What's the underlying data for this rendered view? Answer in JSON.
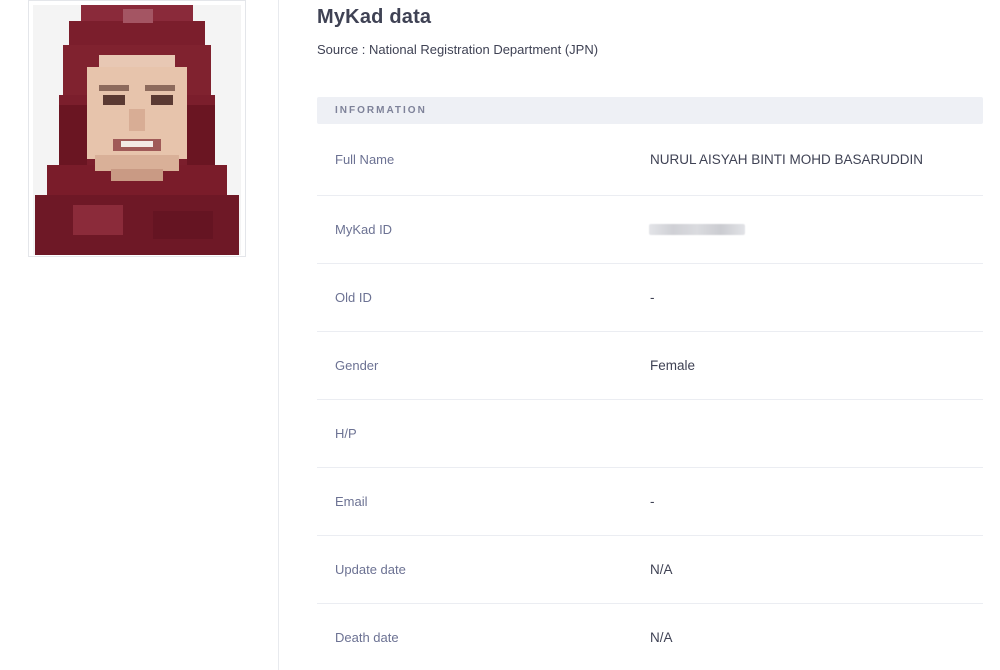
{
  "header": {
    "title": "MyKad data",
    "subtitle": "Source : National Registration Department (JPN)"
  },
  "photo": {
    "icon": "profile-photo-pixelated",
    "colors": {
      "hijab": "#7b1e2c",
      "face": "#e7c4ac",
      "background": "#f4f4f4"
    }
  },
  "information": {
    "heading": "INFORMATION",
    "rows": [
      {
        "label": "Full Name",
        "value": "NURUL AISYAH BINTI MOHD BASARUDDIN"
      },
      {
        "label": "MyKad ID",
        "value": ""
      },
      {
        "label": "Old ID",
        "value": "-"
      },
      {
        "label": "Gender",
        "value": "Female"
      },
      {
        "label": "H/P",
        "value": ""
      },
      {
        "label": "Email",
        "value": "-"
      },
      {
        "label": "Update date",
        "value": "N/A"
      },
      {
        "label": "Death date",
        "value": "N/A"
      }
    ]
  }
}
